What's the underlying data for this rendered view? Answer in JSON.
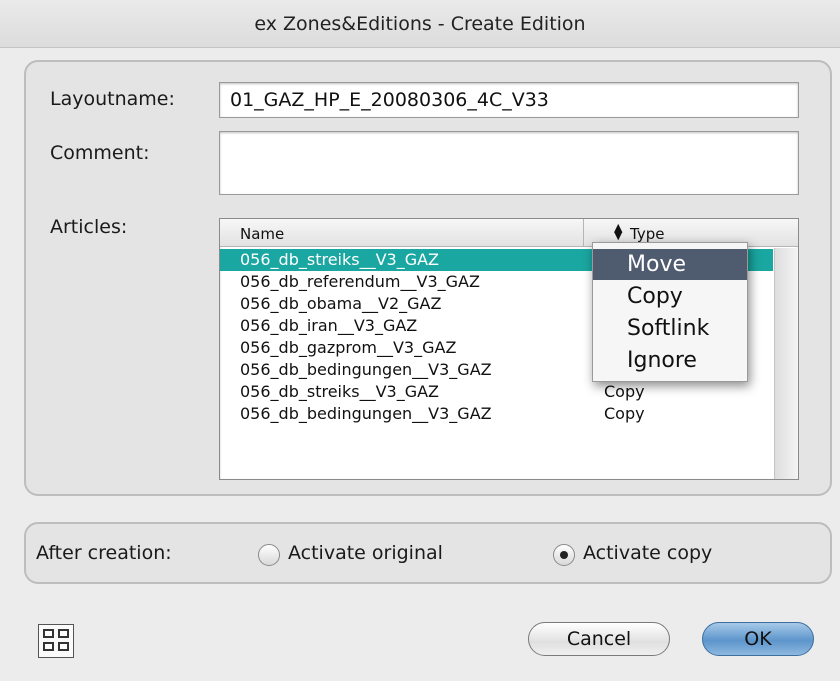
{
  "window": {
    "title": "ex Zones&Editions - Create Edition"
  },
  "form": {
    "layoutname_label": "Layoutname:",
    "layoutname_value": "01_GAZ_HP_E_20080306_4C_V33",
    "comment_label": "Comment:",
    "comment_value": "",
    "articles_label": "Articles:"
  },
  "articles_table": {
    "columns": {
      "name": "Name",
      "type": "Type"
    },
    "rows": [
      {
        "name": "056_db_streiks__V3_GAZ",
        "type": ""
      },
      {
        "name": "056_db_referendum__V3_GAZ",
        "type": ""
      },
      {
        "name": "056_db_obama__V2_GAZ",
        "type": ""
      },
      {
        "name": "056_db_iran__V3_GAZ",
        "type": ""
      },
      {
        "name": "056_db_gazprom__V3_GAZ",
        "type": ""
      },
      {
        "name": "056_db_bedingungen__V3_GAZ",
        "type": ""
      },
      {
        "name": "056_db_streiks__V3_GAZ",
        "type": "Copy"
      },
      {
        "name": "056_db_bedingungen__V3_GAZ",
        "type": "Copy"
      }
    ],
    "selected_row": 0
  },
  "type_menu": {
    "items": [
      "Move",
      "Copy",
      "Softlink",
      "Ignore"
    ],
    "highlighted": "Move"
  },
  "after_creation": {
    "label": "After creation:",
    "option_original": "Activate original",
    "option_copy": "Activate copy",
    "selected": "Activate copy"
  },
  "buttons": {
    "cancel": "Cancel",
    "ok": "OK"
  },
  "colors": {
    "selection": "#1aa7a1",
    "menu_highlight": "#4f5b6e",
    "default_button": "#5d95cc"
  },
  "icons": [
    "radio-unselected-icon",
    "radio-selected-icon",
    "sort-arrows-icon",
    "layout-grid-icon"
  ]
}
